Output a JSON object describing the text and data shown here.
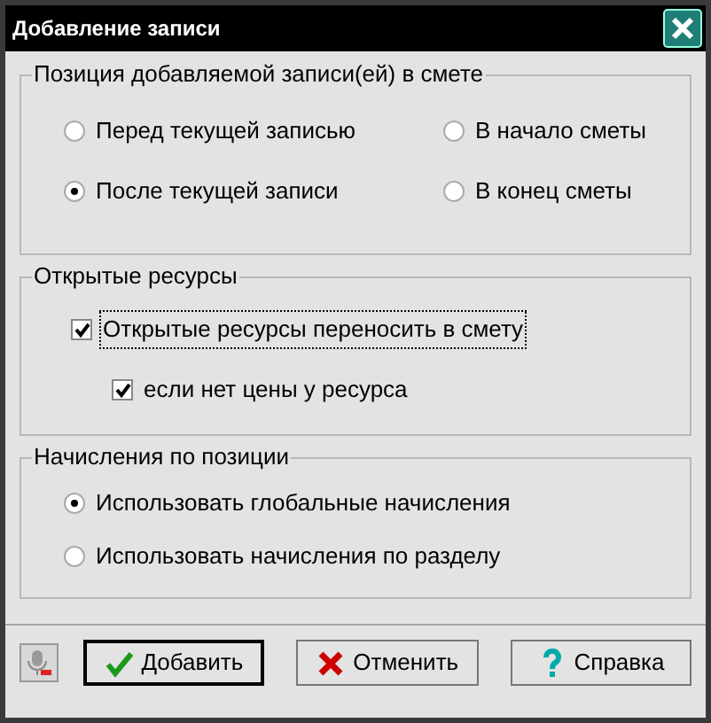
{
  "window": {
    "title": "Добавление записи"
  },
  "position_group": {
    "title": "Позиция добавляемой записи(ей) в смете",
    "options": [
      {
        "label": "Перед текущей записью",
        "selected": false
      },
      {
        "label": "В начало сметы",
        "selected": false
      },
      {
        "label": "После текущей записи",
        "selected": true
      },
      {
        "label": "В конец сметы",
        "selected": false
      }
    ]
  },
  "resources_group": {
    "title": "Открытые ресурсы",
    "checkboxes": [
      {
        "label": "Открытые ресурсы переносить в смету",
        "checked": true,
        "focused": true
      },
      {
        "label": "если нет цены у ресурса",
        "checked": true,
        "focused": false
      }
    ]
  },
  "charges_group": {
    "title": "Начисления по позиции",
    "options": [
      {
        "label": "Использовать глобальные начисления",
        "selected": true
      },
      {
        "label": "Использовать начисления по разделу",
        "selected": false
      }
    ]
  },
  "buttons": [
    {
      "label": "Добавить",
      "kind": "ok"
    },
    {
      "label": "Отменить",
      "kind": "cancel"
    },
    {
      "label": "Справка",
      "kind": "help"
    }
  ]
}
